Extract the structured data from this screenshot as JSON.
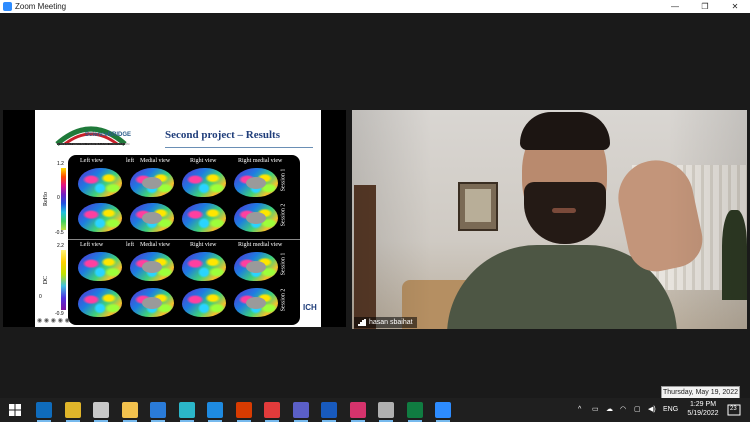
{
  "window": {
    "title": "Zoom Meeting",
    "controls": [
      "—",
      "❐",
      "✕"
    ]
  },
  "share": {
    "logo_text": "ScienceBRIDGE",
    "logo_sub": "STRENGTHENING PHARMA AND INNOVATION",
    "slide_title": "Second project – Results",
    "top_labels": [
      "Left view",
      "left",
      "Medial view",
      "Right view",
      "Right medial view"
    ],
    "bottom_labels": [
      "Left view",
      "left",
      "Medial view",
      "Right view",
      "Right medial view"
    ],
    "metric_top": "ReHo",
    "metric_bottom": "DC",
    "scale_top": [
      "1.2",
      "0",
      "-0.5"
    ],
    "scale_bottom": [
      "2.2",
      "0",
      "-0.9"
    ],
    "sessions": [
      "Session 1",
      "Session 2",
      "Session 1",
      "Session 2"
    ],
    "ich": "ICH"
  },
  "participant": {
    "name": "hasan sbaihat"
  },
  "tooltip": "Thursday, May 19, 2022",
  "taskbar": {
    "apps": [
      {
        "name": "outlook",
        "color": "#0f6cbd"
      },
      {
        "name": "chrome",
        "color": "#e0b52a"
      },
      {
        "name": "photos",
        "color": "#c9c9c9"
      },
      {
        "name": "file-explorer",
        "color": "#f2c14e"
      },
      {
        "name": "calendar",
        "color": "#2a7bd8"
      },
      {
        "name": "edge",
        "color": "#2bb6c9"
      },
      {
        "name": "mail",
        "color": "#1e8ae0"
      },
      {
        "name": "office",
        "color": "#d83b01"
      },
      {
        "name": "anydesk",
        "color": "#e23b3b"
      },
      {
        "name": "teams",
        "color": "#5b5fc7"
      },
      {
        "name": "word",
        "color": "#185abd"
      },
      {
        "name": "snipping",
        "color": "#d6336c"
      },
      {
        "name": "media",
        "color": "#b0b0b0"
      },
      {
        "name": "excel",
        "color": "#107c41"
      },
      {
        "name": "zoom",
        "color": "#2d8cff"
      }
    ],
    "tray_caret": "^",
    "language": "ENG",
    "time": "1:29 PM",
    "date": "5/19/2022",
    "notifications": "23"
  }
}
